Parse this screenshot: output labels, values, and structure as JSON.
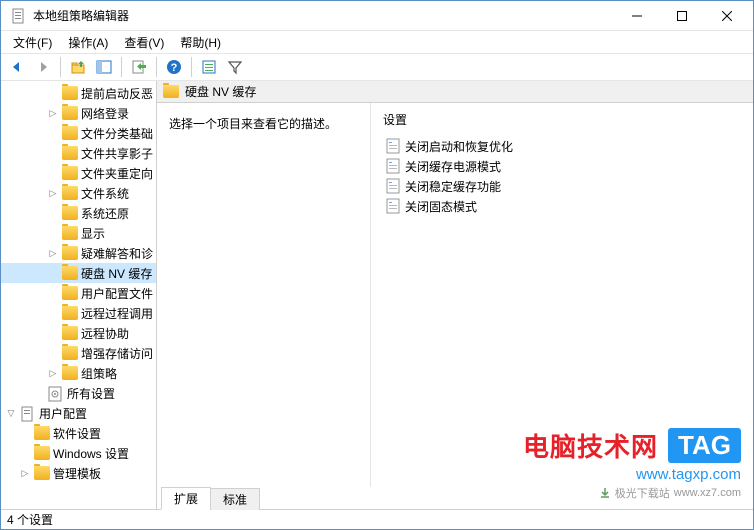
{
  "window": {
    "title": "本地组策略编辑器"
  },
  "menu": {
    "file": "文件(F)",
    "action": "操作(A)",
    "view": "查看(V)",
    "help": "帮助(H)"
  },
  "tree": {
    "items": [
      {
        "label": "提前启动反恶",
        "indent": 3,
        "expand": ""
      },
      {
        "label": "网络登录",
        "indent": 3,
        "expand": "›"
      },
      {
        "label": "文件分类基础",
        "indent": 3,
        "expand": ""
      },
      {
        "label": "文件共享影子",
        "indent": 3,
        "expand": ""
      },
      {
        "label": "文件夹重定向",
        "indent": 3,
        "expand": ""
      },
      {
        "label": "文件系统",
        "indent": 3,
        "expand": "›"
      },
      {
        "label": "系统还原",
        "indent": 3,
        "expand": ""
      },
      {
        "label": "显示",
        "indent": 3,
        "expand": ""
      },
      {
        "label": "疑难解答和诊",
        "indent": 3,
        "expand": "›"
      },
      {
        "label": "硬盘 NV 缓存",
        "indent": 3,
        "expand": "",
        "selected": true
      },
      {
        "label": "用户配置文件",
        "indent": 3,
        "expand": ""
      },
      {
        "label": "远程过程调用",
        "indent": 3,
        "expand": ""
      },
      {
        "label": "远程协助",
        "indent": 3,
        "expand": ""
      },
      {
        "label": "增强存储访问",
        "indent": 3,
        "expand": ""
      },
      {
        "label": "组策略",
        "indent": 3,
        "expand": "›"
      },
      {
        "label": "所有设置",
        "indent": 2,
        "expand": "",
        "icon": "settings"
      },
      {
        "label": "用户配置",
        "indent": 0,
        "expand": "⌄",
        "icon": "doc"
      },
      {
        "label": "软件设置",
        "indent": 1,
        "expand": ""
      },
      {
        "label": "Windows 设置",
        "indent": 1,
        "expand": ""
      },
      {
        "label": "管理模板",
        "indent": 1,
        "expand": "›"
      }
    ]
  },
  "detail": {
    "header": "硬盘 NV 缓存",
    "desc": "选择一个项目来查看它的描述。",
    "settings_label": "设置",
    "items": [
      {
        "label": "关闭启动和恢复优化"
      },
      {
        "label": "关闭缓存电源模式"
      },
      {
        "label": "关闭稳定缓存功能"
      },
      {
        "label": "关闭固态模式"
      }
    ]
  },
  "tabs": {
    "extended": "扩展",
    "standard": "标准"
  },
  "status": "4 个设置",
  "watermark": {
    "main": "电脑技术网",
    "tag": "TAG",
    "url": "www.tagxp.com",
    "sub_site": "极光下载站",
    "sub_url": "www.xz7.com"
  }
}
